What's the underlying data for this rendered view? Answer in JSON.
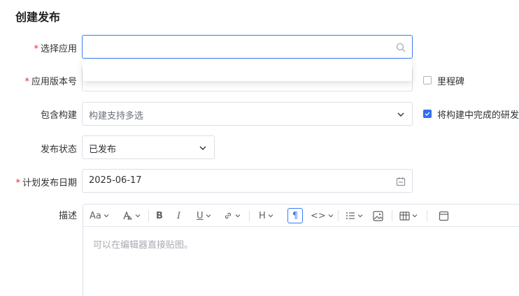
{
  "page": {
    "title": "创建发布"
  },
  "form": {
    "app": {
      "required": "*",
      "label": "选择应用",
      "value": ""
    },
    "version": {
      "required": "*",
      "label": "应用版本号",
      "milestone_label": "里程碑"
    },
    "builds": {
      "label": "包含构建",
      "placeholder": "构建支持多选",
      "auto_label": "将构建中完成的研发"
    },
    "status": {
      "label": "发布状态",
      "value": "已发布"
    },
    "date": {
      "required": "*",
      "label": "计划发布日期",
      "value": "2025-06-17"
    },
    "description": {
      "label": "描述",
      "placeholder": "可以在编辑器直接贴图。"
    }
  },
  "toolbar": {
    "font_size": "Aa",
    "bold": "B",
    "italic": "I",
    "underline": "U",
    "heading": "H",
    "paragraph": "¶",
    "code": "<>"
  },
  "colors": {
    "accent": "#3a7cf5",
    "required": "#f5222d",
    "border": "#dcdfe6"
  }
}
